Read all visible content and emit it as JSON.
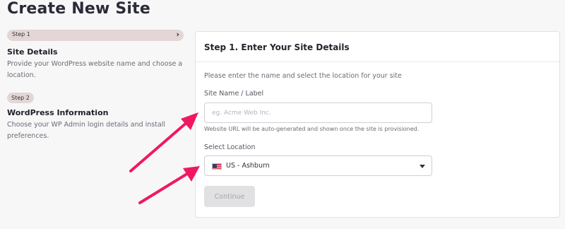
{
  "page": {
    "title": "Create New Site"
  },
  "steps": [
    {
      "tag": "Step 1",
      "title": "Site Details",
      "description": "Provide your WordPress website name and choose a location.",
      "active": true
    },
    {
      "tag": "Step 2",
      "title": "WordPress Information",
      "description": "Choose your WP Admin login details and install preferences.",
      "active": false
    }
  ],
  "form": {
    "heading": "Step 1. Enter Your Site Details",
    "intro": "Please enter the name and select the location for your site",
    "site_name": {
      "label": "Site Name / Label",
      "value": "",
      "placeholder": "eg. Acme Web Inc.",
      "hint": "Website URL will be auto-generated and shown once the site is provisioned."
    },
    "location": {
      "label": "Select Location",
      "selected": "US - Ashburn",
      "flag_icon": "us-flag-icon"
    },
    "continue_label": "Continue"
  },
  "colors": {
    "step_pill": "#e4d6d6",
    "annotation_arrow": "#f0195f",
    "button_disabled_bg": "#e1e1e4"
  }
}
